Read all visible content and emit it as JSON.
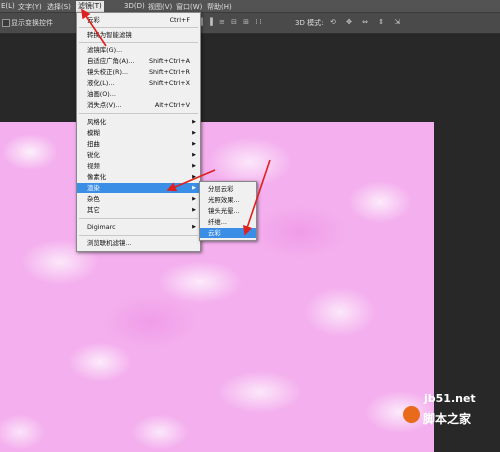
{
  "menubar": {
    "items": [
      "E(L)",
      "文字(Y)",
      "选择(S)",
      "滤镜(T)",
      "3D(D)",
      "视图(V)",
      "窗口(W)",
      "帮助(H)"
    ],
    "active_index": 3
  },
  "options_bar": {
    "show_transform_label": "显示变换控件",
    "mode_label": "3D 模式:"
  },
  "filter_menu": {
    "items": [
      {
        "label": "云彩",
        "shortcut": "Ctrl+F"
      },
      {
        "label": "转换为智能滤镜"
      },
      {
        "label": "滤镜库(G)..."
      },
      {
        "label": "自适应广角(A)...",
        "shortcut": "Shift+Ctrl+A"
      },
      {
        "label": "镜头校正(R)...",
        "shortcut": "Shift+Ctrl+R"
      },
      {
        "label": "液化(L)...",
        "shortcut": "Shift+Ctrl+X"
      },
      {
        "label": "油画(O)..."
      },
      {
        "label": "消失点(V)...",
        "shortcut": "Alt+Ctrl+V"
      },
      {
        "label": "风格化"
      },
      {
        "label": "模糊"
      },
      {
        "label": "扭曲"
      },
      {
        "label": "锐化"
      },
      {
        "label": "视频"
      },
      {
        "label": "像素化"
      },
      {
        "label": "渲染"
      },
      {
        "label": "杂色"
      },
      {
        "label": "其它"
      },
      {
        "label": "Digimarc"
      },
      {
        "label": "浏览联机滤镜..."
      }
    ],
    "highlighted": "渲染"
  },
  "render_submenu": {
    "items": [
      "分层云彩",
      "光照效果...",
      "镜头光晕...",
      "纤维...",
      "云彩"
    ],
    "highlighted": "云彩"
  },
  "watermark": {
    "site": "jb51.net",
    "name": "脚本之家"
  },
  "colors": {
    "accent_highlight": "#3a8ee6",
    "arrow_red": "#e02020",
    "canvas_pink": "#f4b0ee",
    "workspace": "#282828"
  }
}
